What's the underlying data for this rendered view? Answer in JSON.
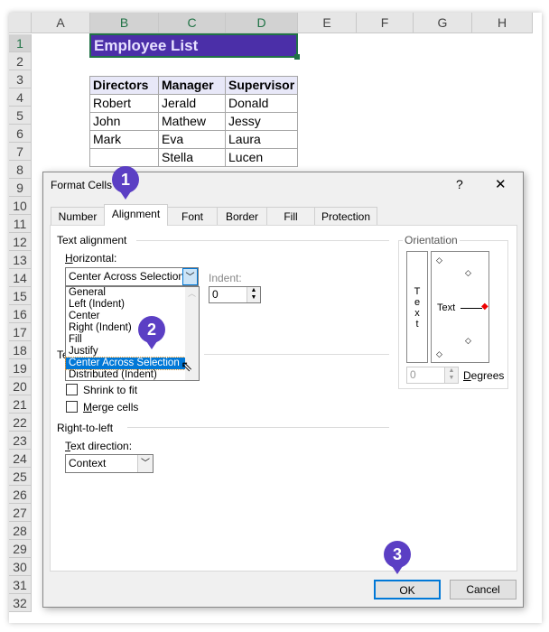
{
  "sheet": {
    "columns": [
      "A",
      "B",
      "C",
      "D",
      "E",
      "F",
      "G",
      "H"
    ],
    "rows": [
      "1",
      "2",
      "3",
      "4",
      "5",
      "6",
      "7",
      "8",
      "9",
      "10",
      "11",
      "12",
      "13",
      "14",
      "15",
      "16",
      "17",
      "18",
      "19",
      "20",
      "21",
      "22",
      "23",
      "24",
      "25",
      "26",
      "27",
      "28",
      "29",
      "30",
      "31",
      "32"
    ],
    "title": "Employee List",
    "title_color": "#4b2fa8",
    "table": {
      "headers": [
        "Directors",
        "Manager",
        "Supervisor"
      ],
      "rows": [
        [
          "Robert",
          "Jerald",
          "Donald"
        ],
        [
          "John",
          "Mathew",
          "Jessy"
        ],
        [
          "Mark",
          "Eva",
          "Laura"
        ],
        [
          "",
          "Stella",
          "Lucen"
        ]
      ]
    }
  },
  "dialog": {
    "title": "Format Cells",
    "help": "?",
    "close": "✕",
    "tabs": [
      "Number",
      "Alignment",
      "Font",
      "Border",
      "Fill",
      "Protection"
    ],
    "active_tab": "Alignment",
    "text_alignment": {
      "heading": "Text alignment",
      "horizontal_label": "Horizontal:",
      "horizontal_value": "Center Across Selection",
      "options": [
        "General",
        "Left (Indent)",
        "Center",
        "Right (Indent)",
        "Fill",
        "Justify",
        "Center Across Selection",
        "Distributed (Indent)"
      ],
      "indent_label": "Indent:",
      "indent_value": "0"
    },
    "text_control": {
      "heading_partial": "Te",
      "shrink": "Shrink to fit",
      "merge": "Merge cells"
    },
    "rtl": {
      "heading": "Right-to-left",
      "direction_label": "Text direction:",
      "direction_value": "Context"
    },
    "orientation": {
      "heading": "Orientation",
      "vertical_text": [
        "T",
        "e",
        "x",
        "t"
      ],
      "dial_text": "Text",
      "degrees_value": "0",
      "degrees_label": "Degrees"
    },
    "ok": "OK",
    "cancel": "Cancel"
  },
  "badges": [
    "1",
    "2",
    "3"
  ],
  "accent": "#5b3fc4"
}
